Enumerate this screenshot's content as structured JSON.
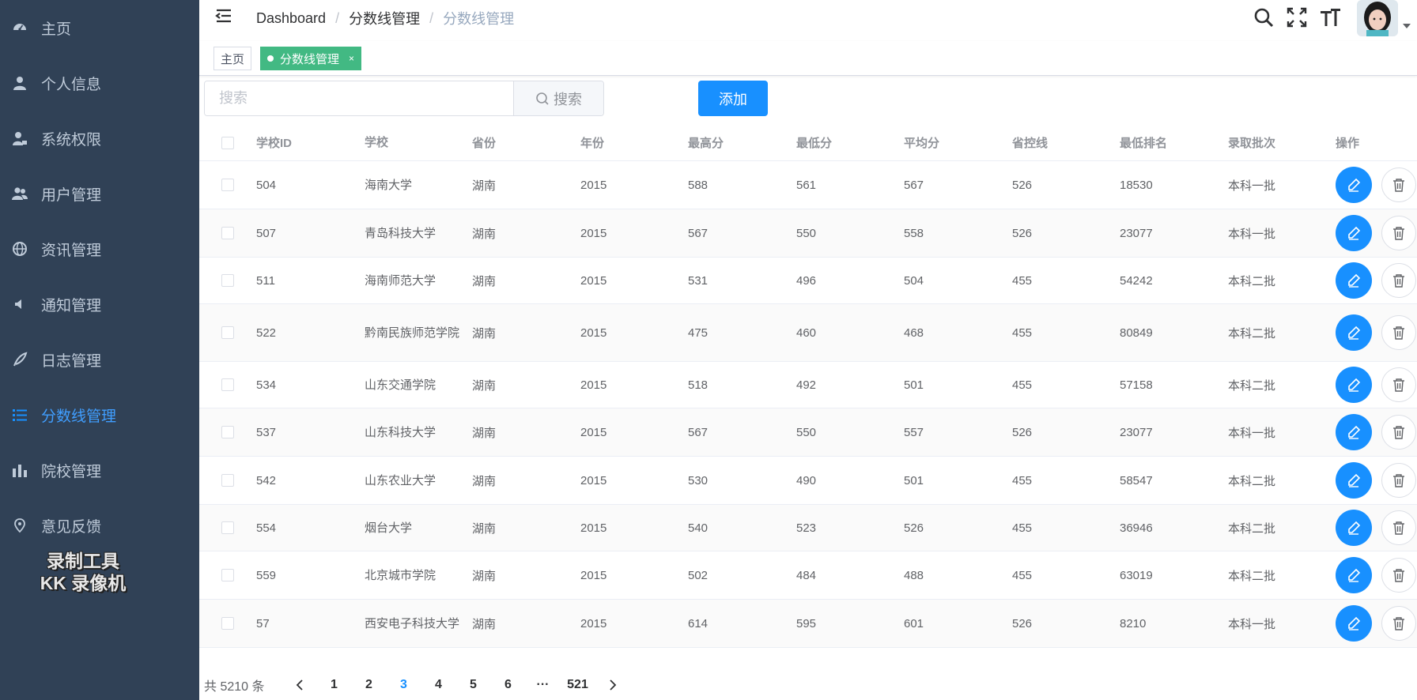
{
  "sidebar": {
    "items": [
      {
        "label": "主页",
        "icon": "dashboard-icon"
      },
      {
        "label": "个人信息",
        "icon": "user-icon"
      },
      {
        "label": "系统权限",
        "icon": "user-lock-icon"
      },
      {
        "label": "用户管理",
        "icon": "users-icon"
      },
      {
        "label": "资讯管理",
        "icon": "globe-icon"
      },
      {
        "label": "通知管理",
        "icon": "speaker-icon"
      },
      {
        "label": "日志管理",
        "icon": "feather-icon"
      },
      {
        "label": "分数线管理",
        "icon": "list-icon",
        "active": true
      },
      {
        "label": "院校管理",
        "icon": "bar-chart-icon"
      },
      {
        "label": "意见反馈",
        "icon": "location-pin-icon"
      }
    ],
    "watermark": [
      "录制工具",
      "KK 录像机"
    ]
  },
  "breadcrumb": [
    "Dashboard",
    "分数线管理",
    "分数线管理"
  ],
  "tags": [
    {
      "label": "主页"
    },
    {
      "label": "分数线管理",
      "close": "×",
      "active": true
    }
  ],
  "toolbar": {
    "search_placeholder": "搜索",
    "search_button": "搜索",
    "add_button": "添加"
  },
  "table": {
    "columns": [
      "学校ID",
      "学校",
      "省份",
      "年份",
      "最高分",
      "最低分",
      "平均分",
      "省控线",
      "最低排名",
      "录取批次",
      "操作"
    ],
    "rows": [
      [
        "504",
        "海南大学",
        "湖南",
        "2015",
        "588",
        "561",
        "567",
        "526",
        "18530",
        "本科一批"
      ],
      [
        "507",
        "青岛科技大学",
        "湖南",
        "2015",
        "567",
        "550",
        "558",
        "526",
        "23077",
        "本科一批"
      ],
      [
        "511",
        "海南师范大学",
        "湖南",
        "2015",
        "531",
        "496",
        "504",
        "455",
        "54242",
        "本科二批"
      ],
      [
        "522",
        "黔南民族师范学院",
        "湖南",
        "2015",
        "475",
        "460",
        "468",
        "455",
        "80849",
        "本科二批"
      ],
      [
        "534",
        "山东交通学院",
        "湖南",
        "2015",
        "518",
        "492",
        "501",
        "455",
        "57158",
        "本科二批"
      ],
      [
        "537",
        "山东科技大学",
        "湖南",
        "2015",
        "567",
        "550",
        "557",
        "526",
        "23077",
        "本科一批"
      ],
      [
        "542",
        "山东农业大学",
        "湖南",
        "2015",
        "530",
        "490",
        "501",
        "455",
        "58547",
        "本科二批"
      ],
      [
        "554",
        "烟台大学",
        "湖南",
        "2015",
        "540",
        "523",
        "526",
        "455",
        "36946",
        "本科二批"
      ],
      [
        "559",
        "北京城市学院",
        "湖南",
        "2015",
        "502",
        "484",
        "488",
        "455",
        "63019",
        "本科二批"
      ],
      [
        "57",
        "西安电子科技大学",
        "湖南",
        "2015",
        "614",
        "595",
        "601",
        "526",
        "8210",
        "本科一批"
      ]
    ]
  },
  "pagination": {
    "total": "共 5210 条",
    "pages": [
      "1",
      "2",
      "3",
      "4",
      "5",
      "6",
      "···",
      "521"
    ],
    "current": "3"
  },
  "colors": {
    "sidebar_bg": "#304156",
    "sidebar_text": "#bfcbd9",
    "accent": "#1890ff",
    "tag_active": "#42b983"
  }
}
